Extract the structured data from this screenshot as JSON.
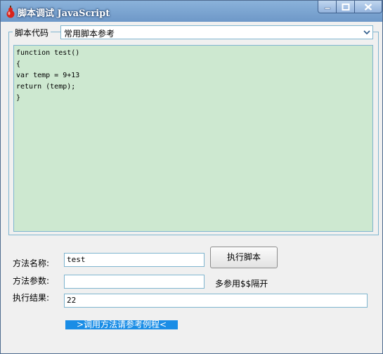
{
  "window": {
    "title": "脚本调试 JavaScript"
  },
  "script_group": {
    "legend": "脚本代码",
    "select_value": "常用脚本参考",
    "code": "function test()\n{\nvar temp = 9+13\nreturn (temp);\n}"
  },
  "form": {
    "method_name_label": "方法名称:",
    "method_name_value": "test",
    "method_params_label": "方法参数:",
    "method_params_value": "",
    "params_hint": "多参用$$隔开",
    "result_label": "执行结果:",
    "result_value": "22",
    "exec_button": "执行脚本",
    "example_link": ">调用方法请参考例程<"
  },
  "icons": {
    "app": "gourd-icon",
    "minimize": "minimize-icon",
    "maximize": "maximize-icon",
    "close": "close-icon",
    "dropdown": "chevron-down-icon"
  },
  "colors": {
    "titlebar": "#7ea6d4",
    "code_background": "#cde8d0",
    "border": "#7fb5cf",
    "link_background": "#1a8de6"
  }
}
